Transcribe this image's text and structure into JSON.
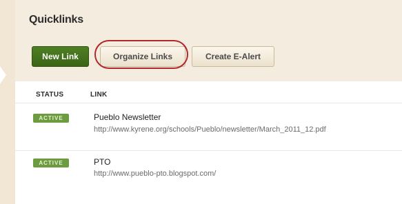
{
  "panel": {
    "title": "Quicklinks"
  },
  "toolbar": {
    "new_link_label": "New Link",
    "organize_links_label": "Organize Links",
    "create_alert_label": "Create E-Alert"
  },
  "table": {
    "columns": [
      "STATUS",
      "LINK"
    ],
    "rows": [
      {
        "status": "ACTIVE",
        "title": "Pueblo Newsletter",
        "url": "http://www.kyrene.org/schools/Pueblo/newsletter/March_2011_12.pdf"
      },
      {
        "status": "ACTIVE",
        "title": "PTO",
        "url": "http://www.pueblo-pto.blogspot.com/"
      }
    ]
  },
  "colors": {
    "accent_green": "#3f6b1a",
    "badge_green": "#6d9b3f",
    "highlight_red": "#b0272c",
    "header_beige": "#f4eddf"
  }
}
